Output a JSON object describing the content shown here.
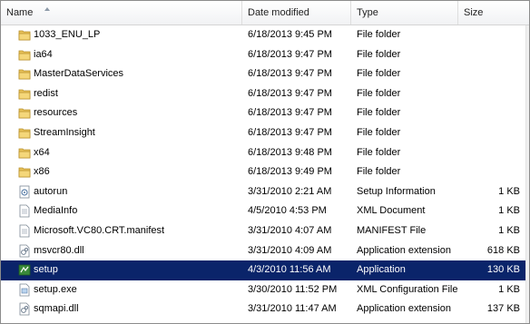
{
  "columns": {
    "name": "Name",
    "date": "Date modified",
    "type": "Type",
    "size": "Size"
  },
  "files": [
    {
      "name": "1033_ENU_LP",
      "date": "6/18/2013 9:45 PM",
      "type": "File folder",
      "size": "",
      "icon": "folder-icon"
    },
    {
      "name": "ia64",
      "date": "6/18/2013 9:47 PM",
      "type": "File folder",
      "size": "",
      "icon": "folder-icon"
    },
    {
      "name": "MasterDataServices",
      "date": "6/18/2013 9:47 PM",
      "type": "File folder",
      "size": "",
      "icon": "folder-icon"
    },
    {
      "name": "redist",
      "date": "6/18/2013 9:47 PM",
      "type": "File folder",
      "size": "",
      "icon": "folder-icon"
    },
    {
      "name": "resources",
      "date": "6/18/2013 9:47 PM",
      "type": "File folder",
      "size": "",
      "icon": "folder-icon"
    },
    {
      "name": "StreamInsight",
      "date": "6/18/2013 9:47 PM",
      "type": "File folder",
      "size": "",
      "icon": "folder-icon"
    },
    {
      "name": "x64",
      "date": "6/18/2013 9:48 PM",
      "type": "File folder",
      "size": "",
      "icon": "folder-icon"
    },
    {
      "name": "x86",
      "date": "6/18/2013 9:49 PM",
      "type": "File folder",
      "size": "",
      "icon": "folder-icon"
    },
    {
      "name": "autorun",
      "date": "3/31/2010 2:21 AM",
      "type": "Setup Information",
      "size": "1 KB",
      "icon": "setup-info-icon"
    },
    {
      "name": "MediaInfo",
      "date": "4/5/2010 4:53 PM",
      "type": "XML Document",
      "size": "1 KB",
      "icon": "document-icon"
    },
    {
      "name": "Microsoft.VC80.CRT.manifest",
      "date": "3/31/2010 4:07 AM",
      "type": "MANIFEST File",
      "size": "1 KB",
      "icon": "document-icon"
    },
    {
      "name": "msvcr80.dll",
      "date": "3/31/2010 4:09 AM",
      "type": "Application extension",
      "size": "618 KB",
      "icon": "dll-icon"
    },
    {
      "name": "setup",
      "date": "4/3/2010 11:56 AM",
      "type": "Application",
      "size": "130 KB",
      "icon": "setup-app-icon",
      "selected": true
    },
    {
      "name": "setup.exe",
      "date": "3/30/2010 11:52 PM",
      "type": "XML Configuration File",
      "size": "1 KB",
      "icon": "config-file-icon"
    },
    {
      "name": "sqmapi.dll",
      "date": "3/31/2010 11:47 AM",
      "type": "Application extension",
      "size": "137 KB",
      "icon": "dll-icon"
    }
  ],
  "colors": {
    "selection": "#0a246a",
    "folder": "#e8c25a"
  }
}
